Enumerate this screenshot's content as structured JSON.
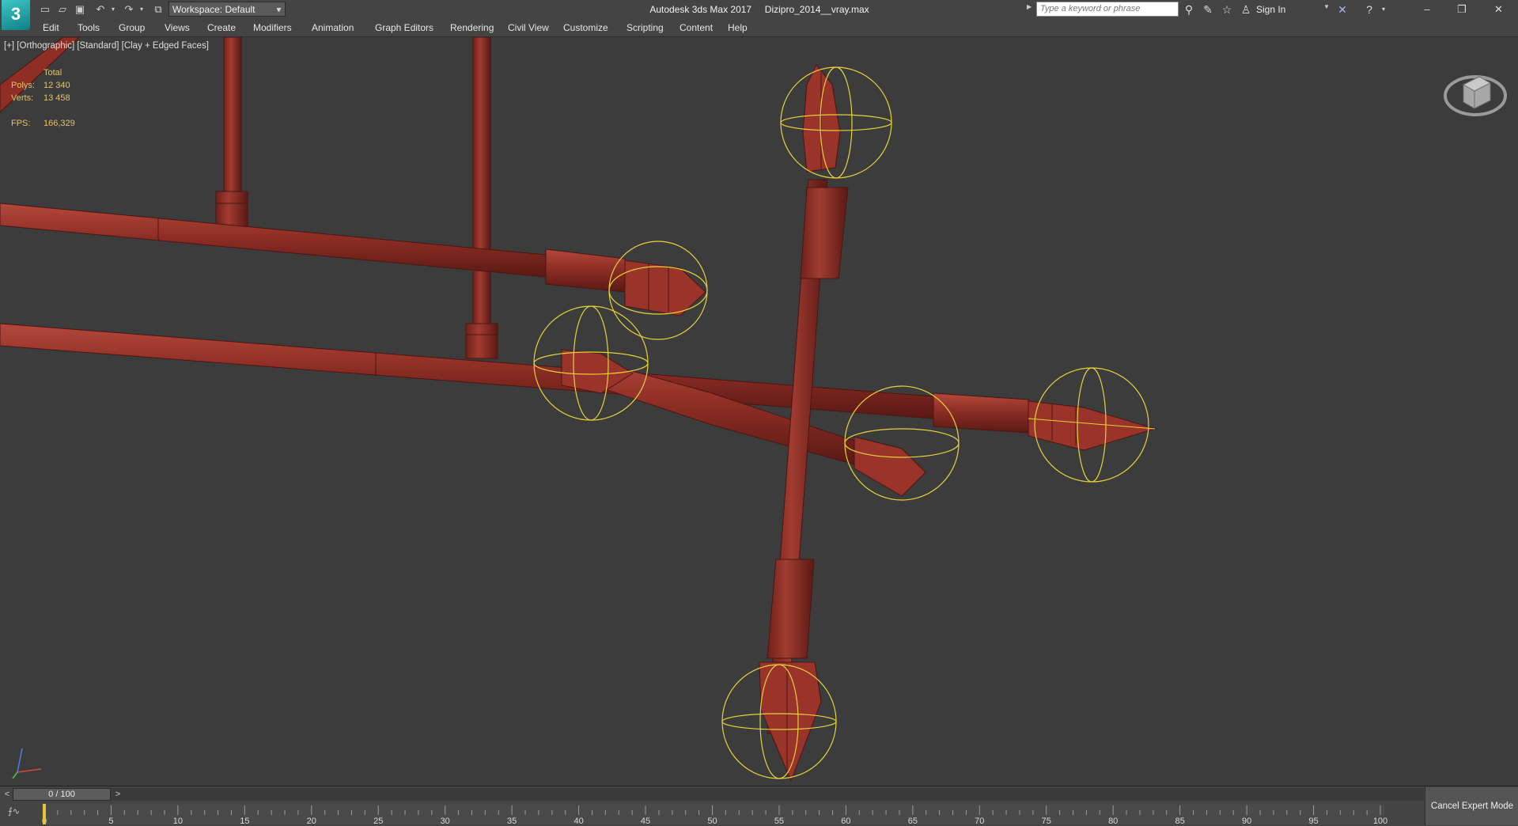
{
  "titlebar": {
    "app_logo_text": "3",
    "workspace_label": "Workspace: Default",
    "title": "Autodesk 3ds Max 2017     Dizipro_2014__vray.max",
    "search_placeholder": "Type a keyword or phrase",
    "sign_in": "Sign In",
    "icons": [
      "new-file-icon",
      "open-file-icon",
      "save-icon",
      "undo-icon",
      "redo-icon",
      "project-folder-icon",
      "binoculars-icon",
      "communication-center-icon",
      "favorites-icon",
      "user-icon",
      "autodesk-exchange-icon",
      "help-icon"
    ],
    "window_buttons": {
      "minimize": "–",
      "restore": "❐",
      "close": "✕"
    }
  },
  "menu": {
    "items": [
      "Edit",
      "Tools",
      "Group",
      "Views",
      "Create",
      "Modifiers",
      "Animation",
      "Graph Editors",
      "Rendering",
      "Civil View",
      "Customize",
      "Scripting",
      "Content",
      "Help"
    ]
  },
  "viewport": {
    "label": "[+] [Orthographic] [Standard] [Clay + Edged Faces]",
    "stats": {
      "header": "Total",
      "polys_label": "Polys:",
      "polys_value": "12 340",
      "verts_label": "Verts:",
      "verts_value": "13 458",
      "fps_label": "FPS:",
      "fps_value": "166,329"
    },
    "colors": {
      "background": "#3c3c3c",
      "geometry": "#8a2a22",
      "edges": "#4a1612",
      "selection": "#e6d23a"
    }
  },
  "timeline": {
    "frame_display": "0 / 100",
    "ticks": [
      "0",
      "5",
      "10",
      "15",
      "20",
      "25",
      "30",
      "35",
      "40",
      "45",
      "50",
      "55",
      "60",
      "65",
      "70",
      "75",
      "80",
      "85",
      "90",
      "95",
      "100"
    ],
    "cancel_expert": "Cancel Expert Mode",
    "prev_symbol": "<",
    "next_symbol": ">"
  }
}
